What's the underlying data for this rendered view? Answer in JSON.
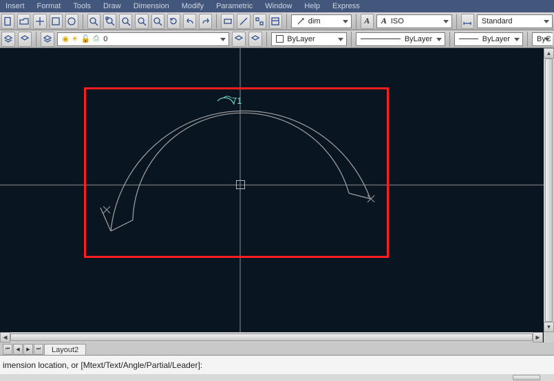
{
  "menu": {
    "items": [
      "Insert",
      "Format",
      "Tools",
      "Draw",
      "Dimension",
      "Modify",
      "Parametric",
      "Window",
      "Help",
      "Express"
    ]
  },
  "toolbar1": {
    "cmd_input": "dim",
    "text_style": "ISO",
    "dim_style": "Standard"
  },
  "toolbar2": {
    "layer_name": "0",
    "color_label": "ByLayer",
    "linetype_label": "ByLayer",
    "lineweight_label": "ByLayer",
    "extra_label": "ByC"
  },
  "drawing": {
    "dim_text": "71"
  },
  "tabs": {
    "layout": "Layout2"
  },
  "command": {
    "prompt": "imension location, or [Mtext/Text/Angle/Partial/Leader]:"
  }
}
